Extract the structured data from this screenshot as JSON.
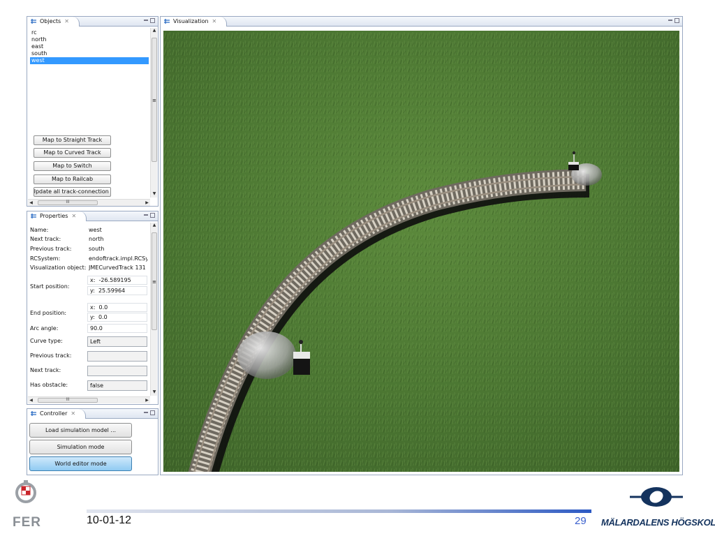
{
  "objects_panel": {
    "tab_label": "Objects",
    "items": [
      "rc",
      "north",
      "east",
      "south",
      "west"
    ],
    "selected": "west",
    "buttons": [
      "Map to Straight Track",
      "Map to Curved Track",
      "Map to Switch",
      "Map to Railcab",
      "Update all track-connection"
    ],
    "scroll_mark": "≡",
    "h_scroll_mark": "III"
  },
  "properties_panel": {
    "tab_label": "Properties",
    "rows": [
      {
        "label": "Name:",
        "value": "west"
      },
      {
        "label": "Next track:",
        "value": "north"
      },
      {
        "label": "Previous track:",
        "value": "south"
      },
      {
        "label": "RCSystem:",
        "value": "endoftrack.impl.RCSy"
      },
      {
        "label": "Visualization object:",
        "value": "JMECurvedTrack 131"
      }
    ],
    "start_position": {
      "label": "Start position:",
      "x": "-26.589195",
      "y": "25.59964"
    },
    "end_position": {
      "label": "End position:",
      "x": "0.0",
      "y": "0.0"
    },
    "x_prefix": "x:",
    "y_prefix": "y:",
    "arc_angle": {
      "label": "Arc angle:",
      "value": "90.0"
    },
    "curve_type": {
      "label": "Curve type:",
      "value": "Left"
    },
    "previous_track_field": {
      "label": "Previous track:",
      "value": ""
    },
    "next_track_field": {
      "label": "Next track:",
      "value": ""
    },
    "has_obstacle": {
      "label": "Has obstacle:",
      "value": "false"
    }
  },
  "controller_panel": {
    "tab_label": "Controller",
    "buttons": [
      "Load simulation model ...",
      "Simulation mode",
      "World editor mode"
    ],
    "active": "World editor mode"
  },
  "visualization_panel": {
    "tab_label": "Visualization"
  },
  "footer": {
    "date": "10-01-12",
    "page_number": "29",
    "university": "MÄLARDALENS HÖGSKOLA",
    "fer_logo_text": "FER"
  },
  "colors": {
    "selection": "#3399ff",
    "grass": "#4f7a33",
    "accent_blue": "#2c59c4"
  }
}
